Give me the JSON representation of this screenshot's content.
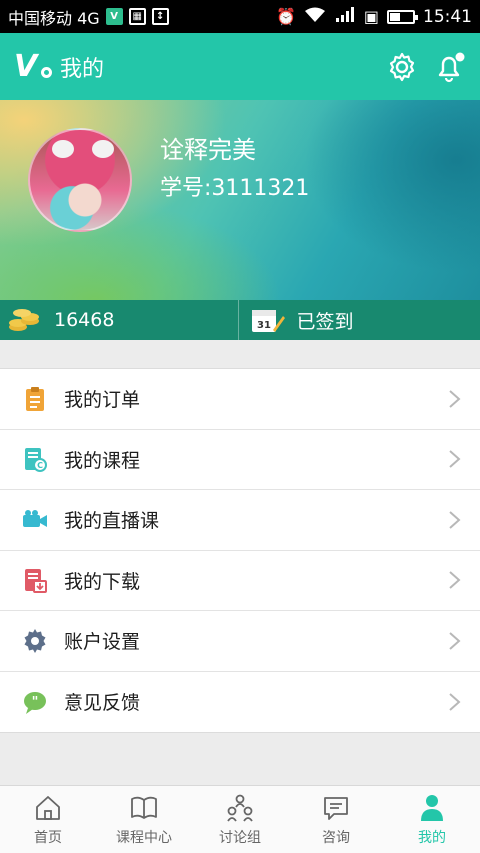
{
  "status_bar": {
    "carrier": "中国移动 4G",
    "network": "4G",
    "time": "15:41"
  },
  "header": {
    "title": "我的",
    "logo_text": "V"
  },
  "profile": {
    "username": "诠释完美",
    "student_id": "学号:3111321"
  },
  "stats": {
    "coins": "16468",
    "checkin": "已签到"
  },
  "menu": [
    {
      "label": "我的订单",
      "icon": "clipboard-icon",
      "color": "#f0a437"
    },
    {
      "label": "我的课程",
      "icon": "course-book-icon",
      "color": "#3ec3c0"
    },
    {
      "label": "我的直播课",
      "icon": "video-camera-icon",
      "color": "#36b9d0"
    },
    {
      "label": "我的下载",
      "icon": "download-doc-icon",
      "color": "#e05a66"
    },
    {
      "label": "账户设置",
      "icon": "gear-icon",
      "color": "#5d6f8a"
    },
    {
      "label": "意见反馈",
      "icon": "feedback-chat-icon",
      "color": "#78c15a"
    }
  ],
  "tabs": [
    {
      "label": "首页",
      "icon": "home-icon"
    },
    {
      "label": "课程中心",
      "icon": "open-book-icon"
    },
    {
      "label": "讨论组",
      "icon": "group-icon"
    },
    {
      "label": "咨询",
      "icon": "message-icon"
    },
    {
      "label": "我的",
      "icon": "person-icon",
      "active": true
    }
  ],
  "colors": {
    "accent": "#23c6a9",
    "stats_bg": "#18896f"
  }
}
